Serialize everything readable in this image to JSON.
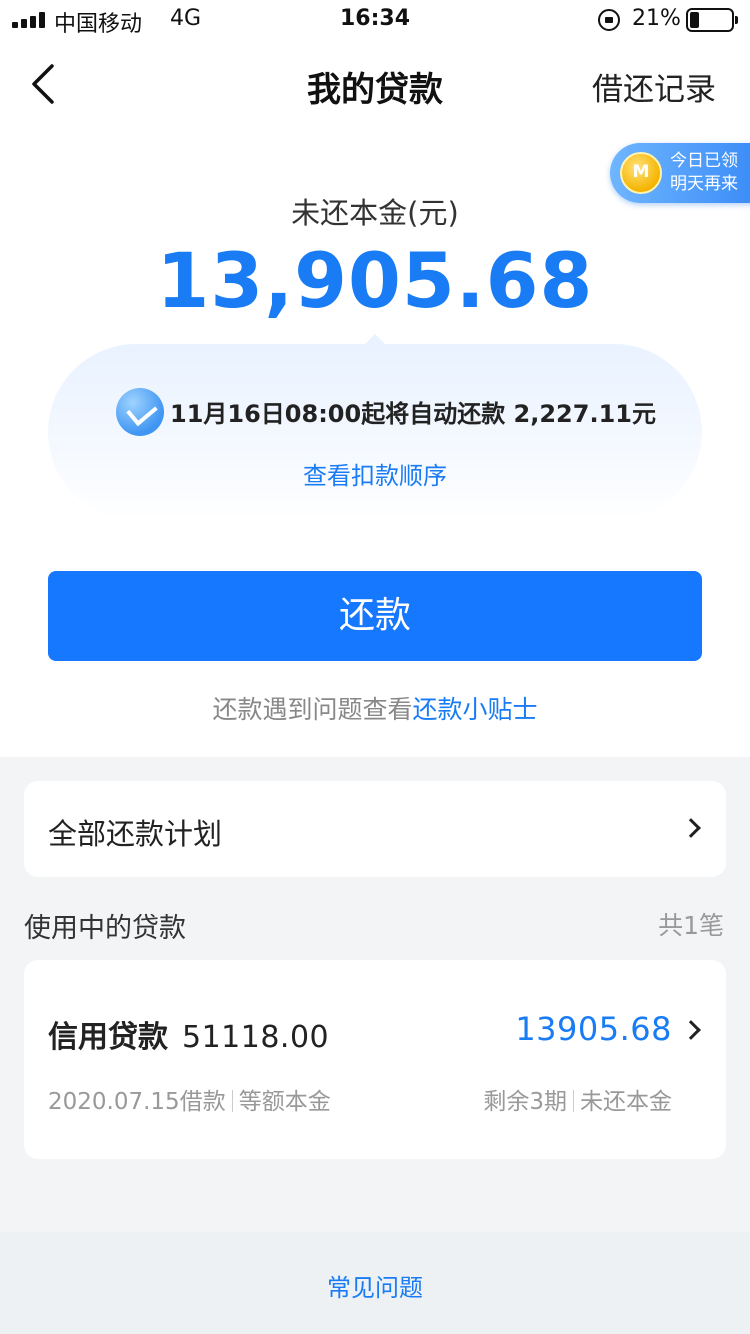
{
  "status_bar": {
    "carrier": "中国移动",
    "network": "4G",
    "time": "16:34",
    "battery_percent": "21%",
    "battery_level": 0.21
  },
  "header": {
    "title": "我的贷款",
    "history_label": "借还记录",
    "back_icon": "chevron-left-icon"
  },
  "reward_badge": {
    "line1": "今日已领",
    "line2": "明天再来",
    "icon": "coin-icon"
  },
  "summary": {
    "principal_label": "未还本金(元)",
    "principal_amount": "13,905.68"
  },
  "autopay": {
    "notice": "11月16日08:00起将自动还款 2,227.11元",
    "deduction_order_link": "查看扣款顺序",
    "icon": "autopay-icon"
  },
  "repay": {
    "button_label": "还款",
    "tips_prefix": "还款遇到问题查看",
    "tips_link": "还款小贴士"
  },
  "plan": {
    "label": "全部还款计划"
  },
  "loans_section": {
    "title": "使用中的贷款",
    "count": "共1笔",
    "items": [
      {
        "name": "信用贷款",
        "original_amount": "51118.00",
        "remaining_amount": "13905.68",
        "borrow_date": "2020.07.15借款",
        "repay_method": "等额本金",
        "remaining_terms": "剩余3期",
        "remaining_label": "未还本金"
      }
    ]
  },
  "footer": {
    "faq_label": "常见问题"
  },
  "colors": {
    "accent": "#1677ff",
    "accent_text": "#1a7cf5",
    "page_background": "#f3f4f6"
  }
}
